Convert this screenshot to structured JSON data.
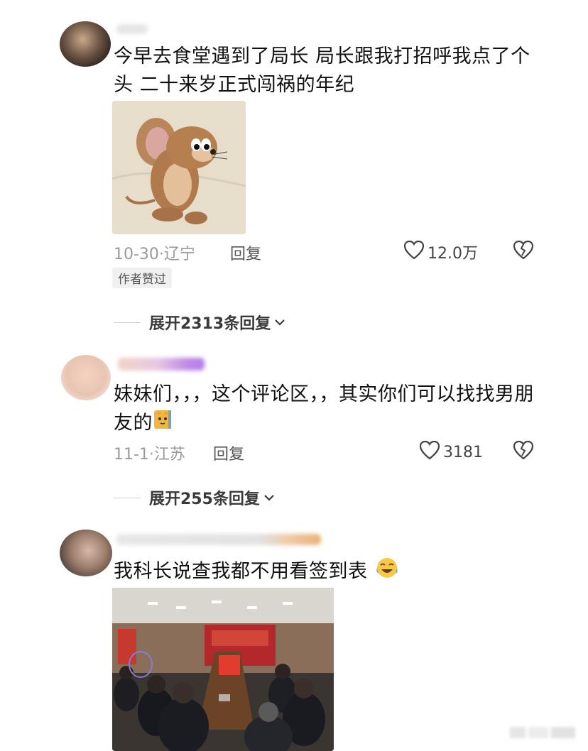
{
  "comments": [
    {
      "text": "今早去食堂遇到了局长 局长跟我打招呼我点了个头 二十来岁正式闯祸的年纪",
      "date_location": "10-30·辽宁",
      "reply_label": "回复",
      "likes": "12.0万",
      "author_tag": "作者赞过",
      "expand_label": "展开2313条回复"
    },
    {
      "text": "妹妹们，，，这个评论区，，其实你们可以找找男朋友的",
      "date_location": "11-1·江苏",
      "reply_label": "回复",
      "likes": "3181",
      "expand_label": "展开255条回复"
    },
    {
      "text": "我科长说查我都不用看签到表"
    }
  ]
}
